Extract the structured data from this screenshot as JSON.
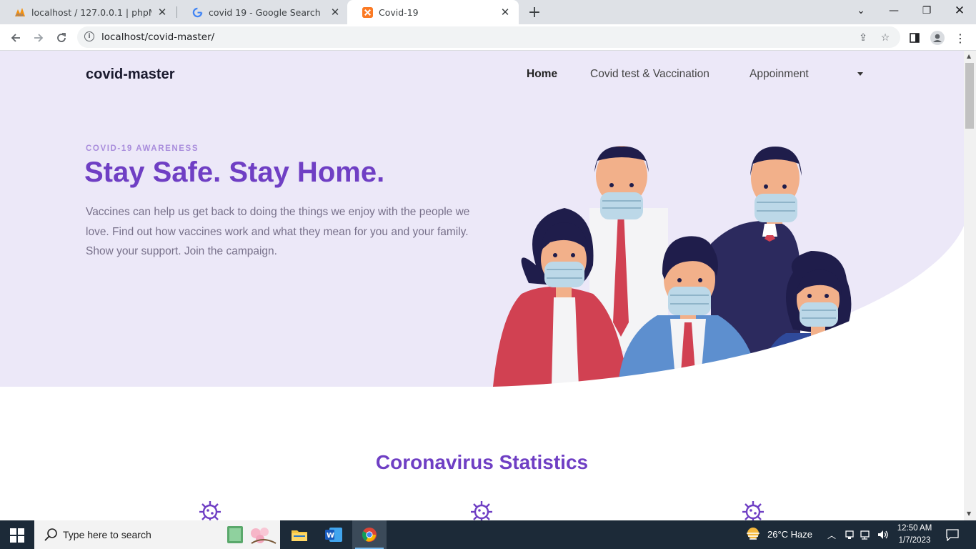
{
  "browser": {
    "tabs": [
      {
        "title": "localhost / 127.0.0.1 | phpMyAdm",
        "favicon": "phpmyadmin-icon"
      },
      {
        "title": "covid 19 - Google Search",
        "favicon": "google-icon"
      },
      {
        "title": "Covid-19",
        "favicon": "xampp-icon"
      }
    ],
    "url": "localhost/covid-master/"
  },
  "page": {
    "brand": "covid-master",
    "nav": {
      "home": "Home",
      "covid_test": "Covid test & Vaccination",
      "appointment": "Appoinment"
    },
    "hero": {
      "eyebrow": "COVID-19 AWARENESS",
      "headline": "Stay Safe. Stay Home.",
      "lede": "Vaccines can help us get back to doing the things we enjoy with the people we love. Find out how vaccines work and what they mean for you and your family. Show your support. Join the campaign."
    },
    "stats_title": "Coronavirus Statistics"
  },
  "taskbar": {
    "search_placeholder": "Type here to search",
    "weather": "26°C  Haze",
    "time": "12:50 AM",
    "date": "1/7/2023"
  },
  "colors": {
    "accent": "#6f3fc4",
    "hero_bg": "#ece8f8",
    "eyebrow": "#a98ddc",
    "taskbar": "#1c2a38"
  }
}
